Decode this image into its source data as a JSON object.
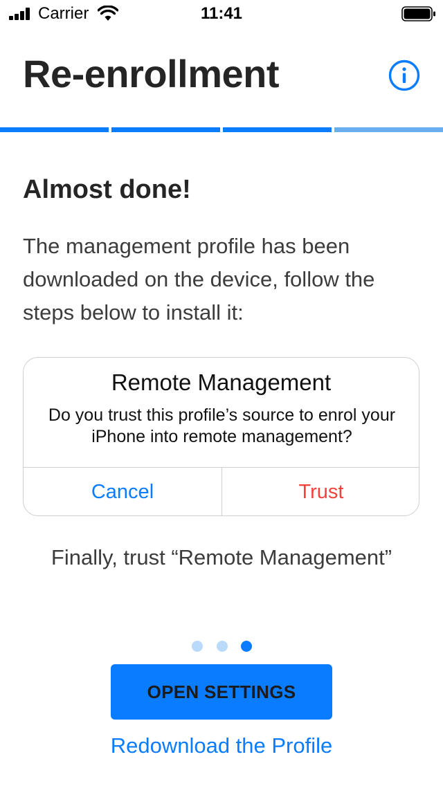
{
  "status_bar": {
    "carrier": "Carrier",
    "time": "11:41",
    "signal_icon": "cellular-signal-icon",
    "wifi_icon": "wifi-icon",
    "battery_icon": "battery-icon"
  },
  "header": {
    "title": "Re-enrollment",
    "info_icon": "info-icon"
  },
  "progress": {
    "total_steps": 4,
    "completed_steps": 3
  },
  "content": {
    "heading": "Almost done!",
    "description": "The management profile has been downloaded on the device, follow the steps below to install it:"
  },
  "alert": {
    "title": "Remote Management",
    "message": "Do you trust this profile’s source to enrol your iPhone into remote management?",
    "cancel_label": "Cancel",
    "trust_label": "Trust"
  },
  "caption": "Finally, trust “Remote Management”",
  "pager": {
    "pages": 3,
    "current_page": 3
  },
  "actions": {
    "open_settings_label": "OPEN SETTINGS",
    "redownload_label": "Redownload the Profile"
  },
  "colors": {
    "accent": "#0a7cff",
    "progress_active": "#0a7cff",
    "progress_pending": "#6aaef2",
    "trust_red": "#f0433a",
    "dot_inactive": "#b9dafa",
    "dot_active": "#0a7cff"
  }
}
